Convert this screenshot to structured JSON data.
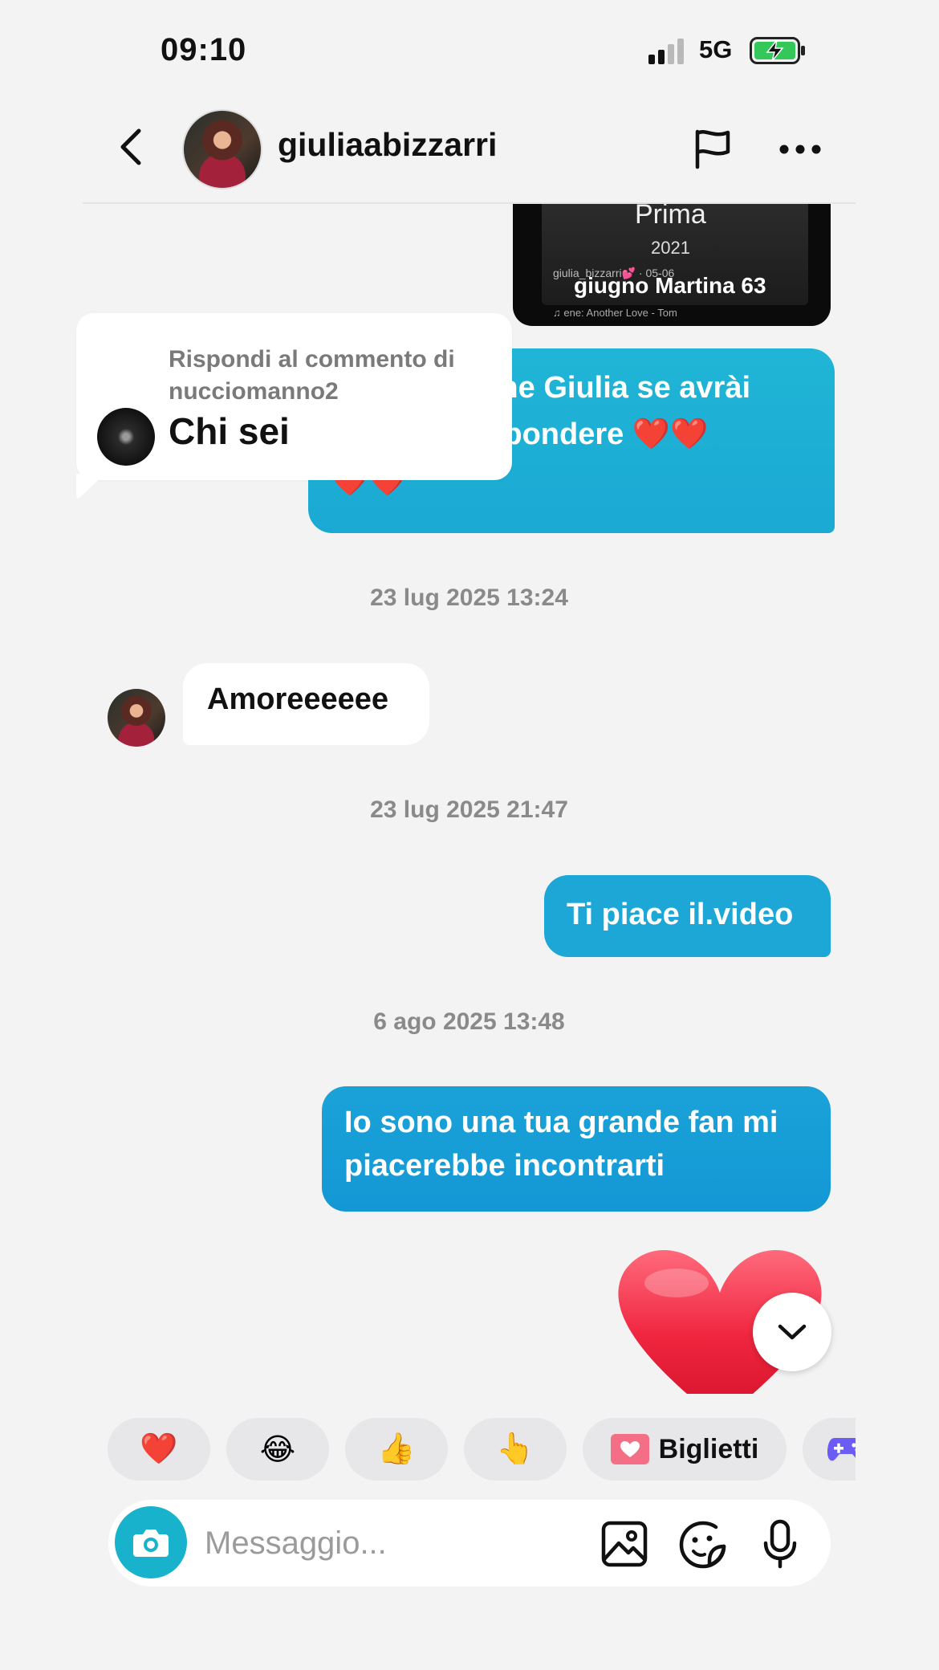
{
  "status_bar": {
    "time": "09:10",
    "network": "5G"
  },
  "header": {
    "username": "giuliaabizzarri"
  },
  "shared_video": {
    "title": "Prima",
    "year": "2021",
    "meta": "giulia_bizzarri💕 · 05-06",
    "caption": "giugno Martina 63",
    "music": "♫ ene: Another Love - Tom"
  },
  "reply_card": {
    "label": "Rispondi al commento di nucciomanno2",
    "text": "Chi sei"
  },
  "messages": {
    "outgoing_1_line1": "Ti voglio bene Giulia se avrài",
    "outgoing_1_line2": "tempo di rispondere ❤️❤️",
    "outgoing_1_line3": "❤️❤️",
    "timestamp_1": "23 lug 2025 13:24",
    "incoming_1": "Amoreeeeee",
    "timestamp_2": "23 lug 2025 21:47",
    "outgoing_2": "Ti piace il.video",
    "timestamp_3": "6 ago 2025 13:48",
    "outgoing_3": "Io sono una tua grande fan mi piacerebbe incontrarti"
  },
  "quick_reactions": {
    "items": [
      "❤️",
      "😂",
      "👍",
      "👆"
    ],
    "tickets_label": "Biglietti"
  },
  "composer": {
    "placeholder": "Messaggio..."
  },
  "colors": {
    "outgoing_bubble": "#1ca7d6",
    "accent": "#19b2cc",
    "heart": "#f0263f"
  }
}
